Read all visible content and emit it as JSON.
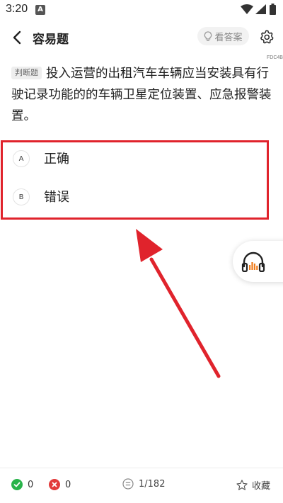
{
  "status_bar": {
    "time": "3:20",
    "app_icon_letter": "A",
    "icons": [
      "wifi-icon",
      "signal-icon",
      "battery-icon"
    ]
  },
  "header": {
    "title": "容易题",
    "answer_button": "看答案",
    "icons": [
      "back-arrow-icon",
      "lightbulb-icon",
      "gear-icon"
    ]
  },
  "question": {
    "code": "FDC4B",
    "type_tag": "判断题",
    "text": "投入运营的出租汽车车辆应当安装具有行驶记录功能的的车辆卫星定位装置、应急报警装置。"
  },
  "options": [
    {
      "letter": "A",
      "text": "正确"
    },
    {
      "letter": "B",
      "text": "错误"
    }
  ],
  "annotation": {
    "highlight_color": "#e0232c",
    "arrow_color": "#e0232c"
  },
  "floating": {
    "icon": "headphones-icon"
  },
  "bottom_bar": {
    "correct_count": "0",
    "wrong_count": "0",
    "progress": "1/182",
    "favorite_label": "收藏",
    "icons": [
      "check-circle-icon",
      "x-circle-icon",
      "list-icon",
      "star-icon"
    ]
  },
  "colors": {
    "correct": "#29b34a",
    "wrong": "#e23b3b",
    "audio_accent": "#f07c1c"
  }
}
